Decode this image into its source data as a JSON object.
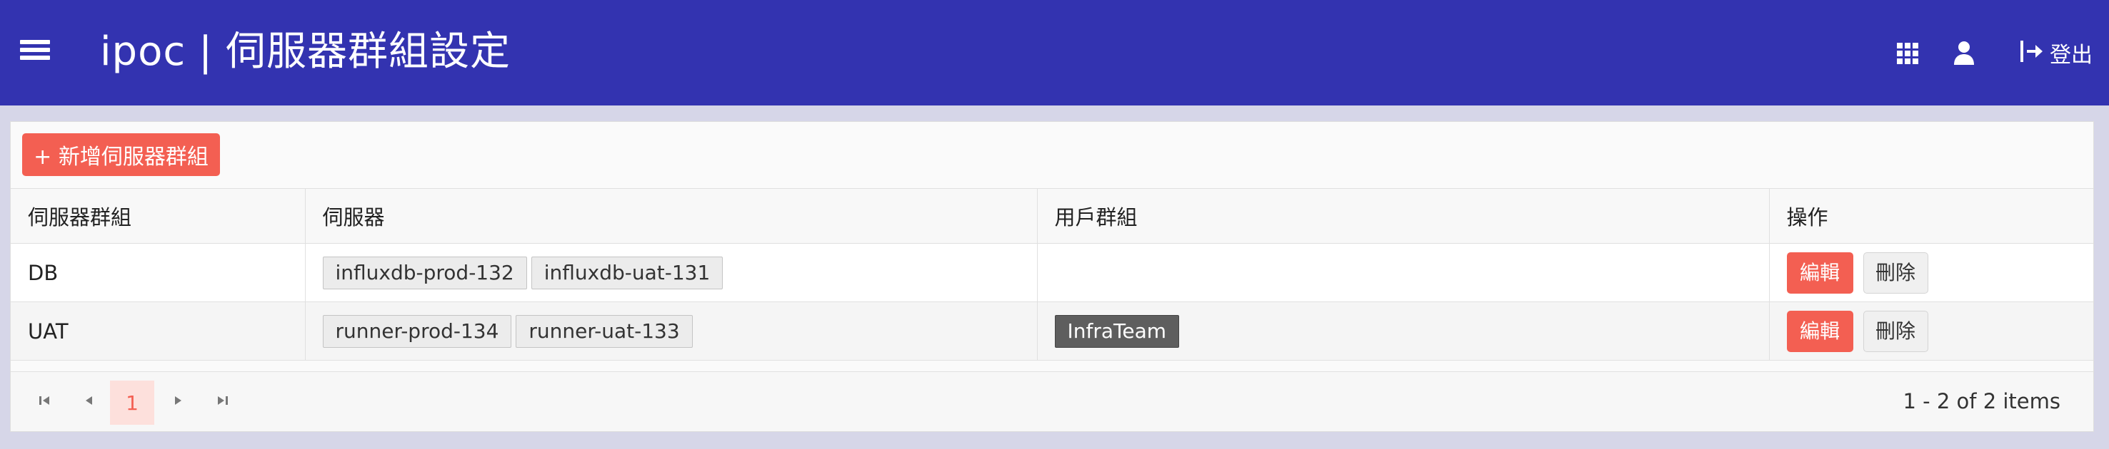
{
  "header": {
    "app_name": "ipoc",
    "separator": "|",
    "page_title": "伺服器群組設定",
    "logout_label": "登出"
  },
  "toolbar": {
    "add_label": "+ 新增伺服器群組"
  },
  "table": {
    "columns": [
      "伺服器群組",
      "伺服器",
      "用戶群組",
      "操作"
    ],
    "rows": [
      {
        "group": "DB",
        "servers": [
          "influxdb-prod-132",
          "influxdb-uat-131"
        ],
        "user_groups": []
      },
      {
        "group": "UAT",
        "servers": [
          "runner-prod-134",
          "runner-uat-133"
        ],
        "user_groups": [
          "InfraTeam"
        ]
      }
    ],
    "edit_label": "編輯",
    "delete_label": "刪除"
  },
  "pager": {
    "current_page": "1",
    "info": "1 - 2 of 2 items"
  },
  "colors": {
    "header_bg": "#3333b0",
    "accent": "#f35f52",
    "page_bg": "#d6d6e8"
  }
}
